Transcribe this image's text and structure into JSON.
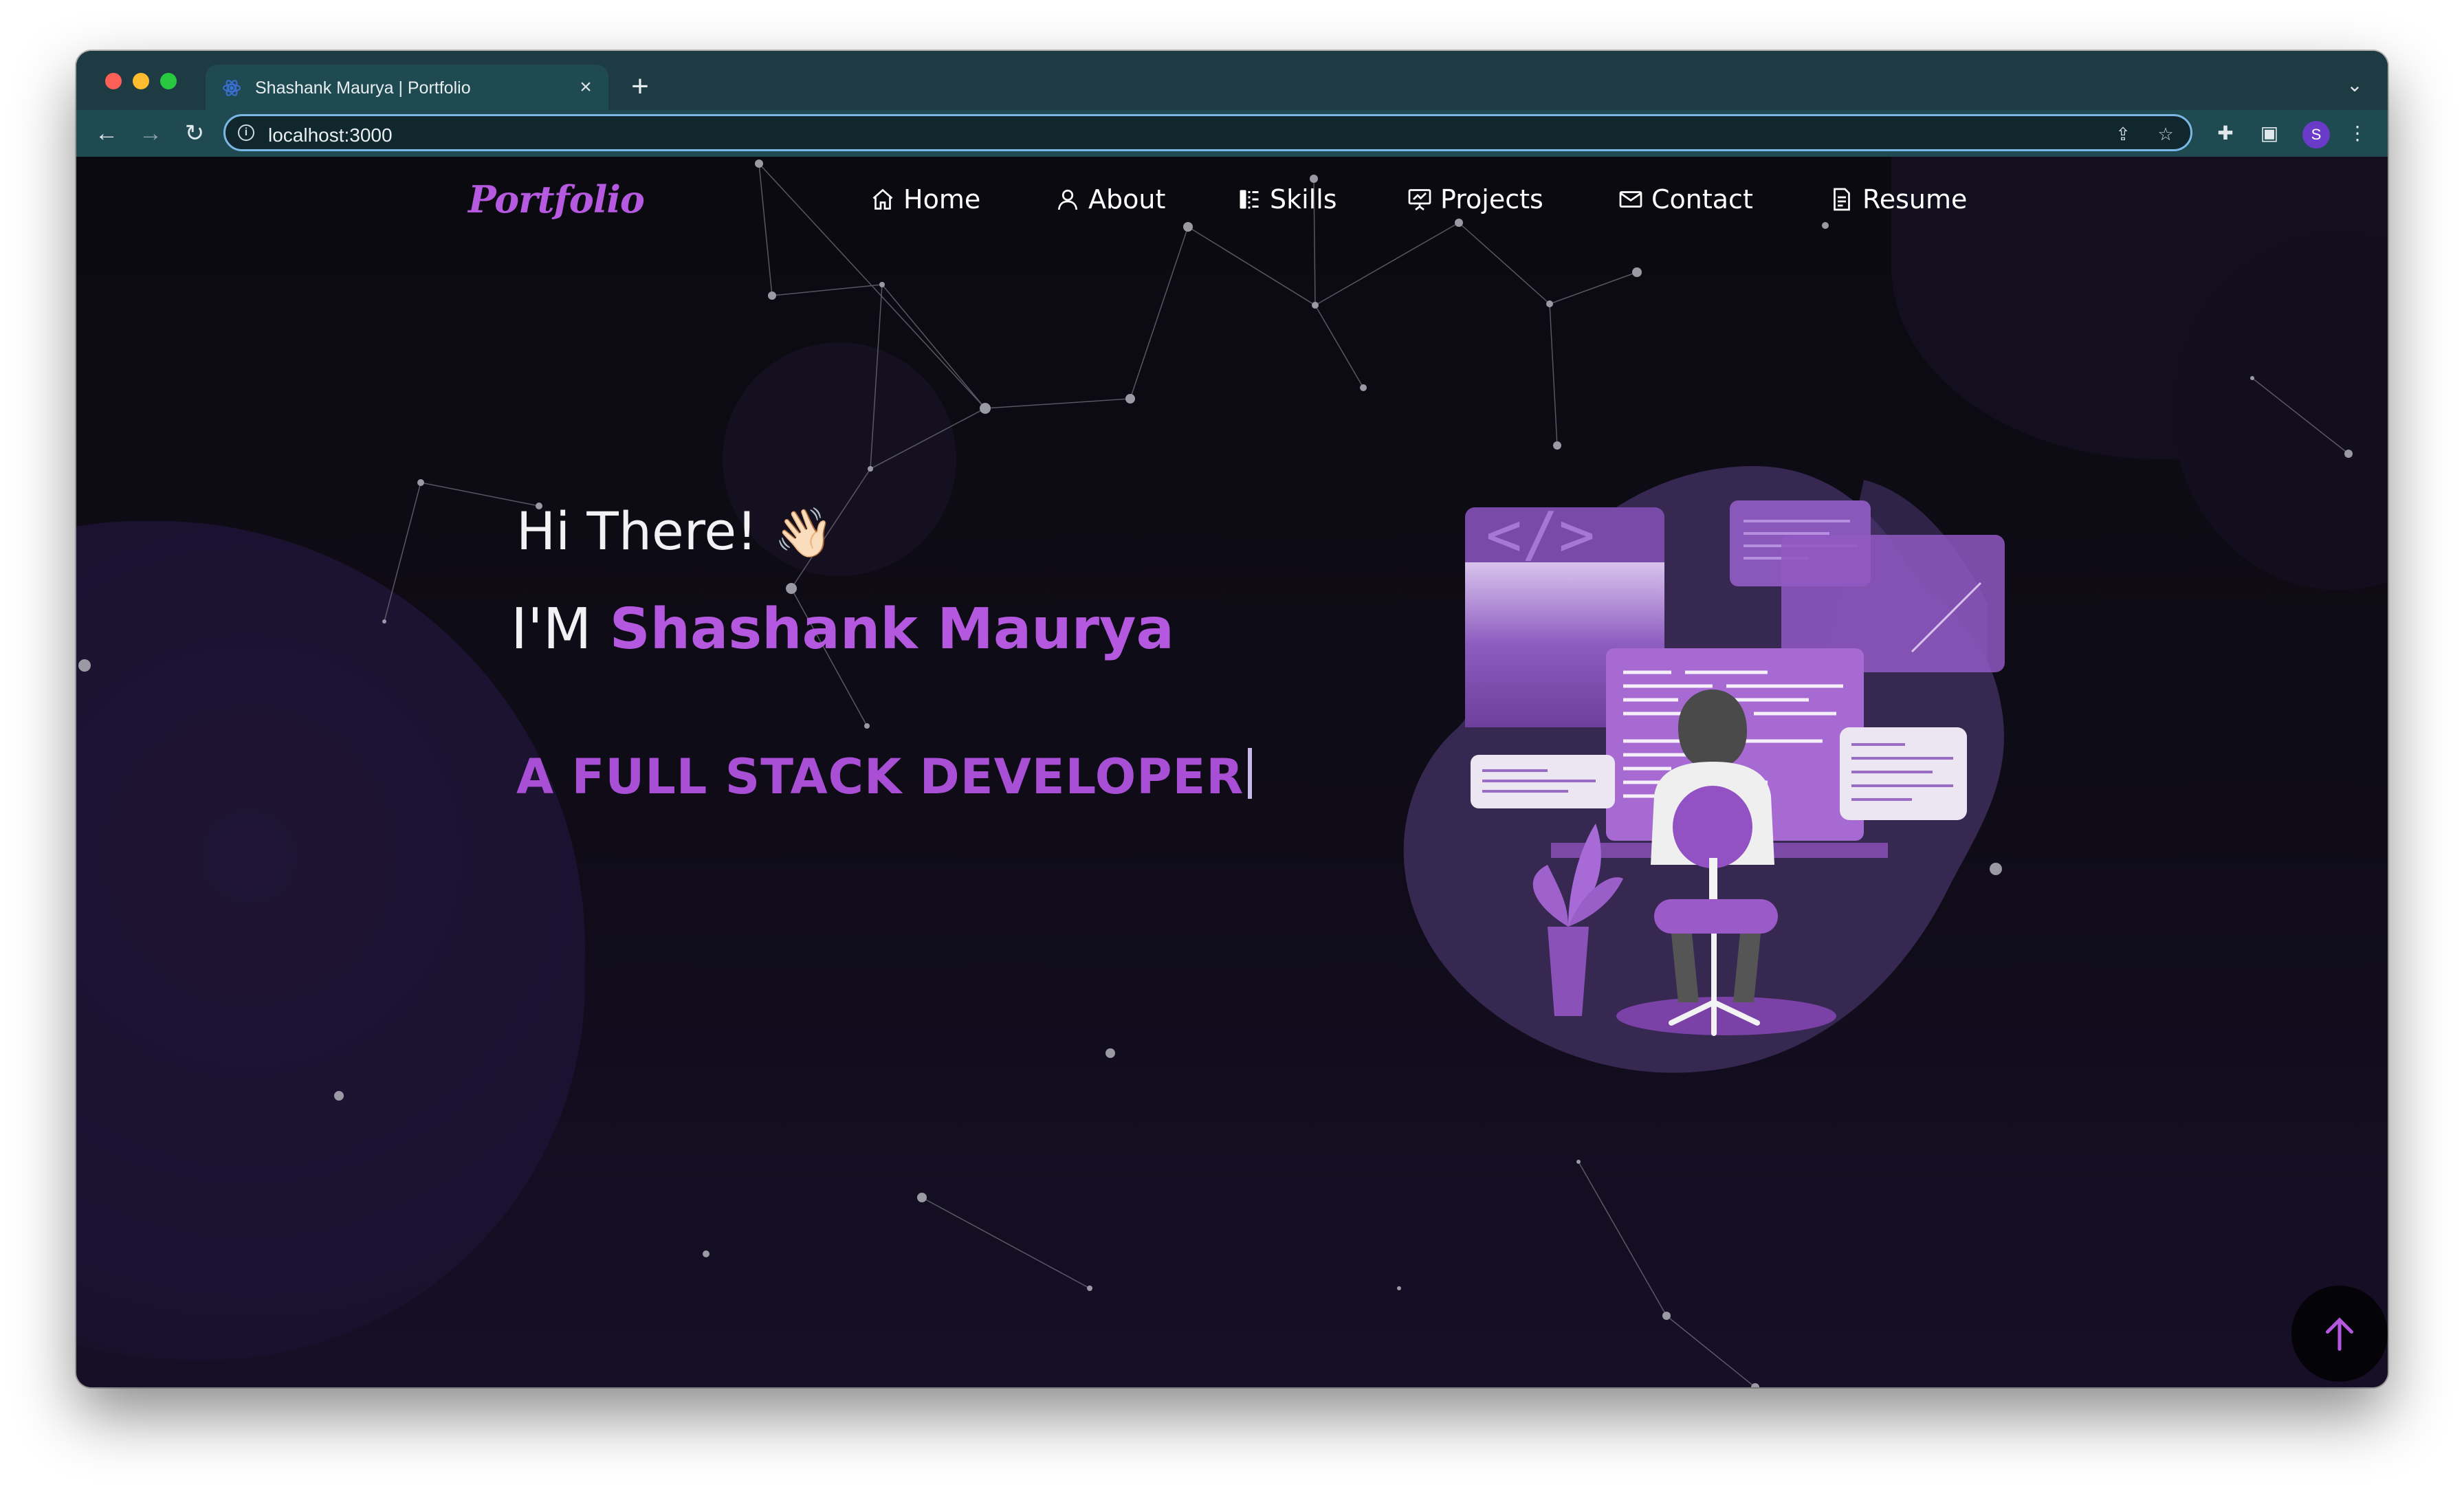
{
  "browser": {
    "tab_title": "Shashank Maurya | Portfolio",
    "tab_close_icon": "close-icon",
    "new_tab_icon": "plus-icon",
    "url": "localhost:3000",
    "profile_initial": "S",
    "colors": {
      "chrome_bg": "#1e3b44",
      "tab_bg": "#1f4a52",
      "omnibox_border": "#7cb8e6"
    }
  },
  "site": {
    "logo": "Portfolio",
    "nav": [
      {
        "label": "Home",
        "icon": "home-icon"
      },
      {
        "label": "About",
        "icon": "user-icon"
      },
      {
        "label": "Skills",
        "icon": "skills-icon"
      },
      {
        "label": "Projects",
        "icon": "presentation-icon"
      },
      {
        "label": "Contact",
        "icon": "mail-icon"
      },
      {
        "label": "Resume",
        "icon": "document-icon"
      }
    ],
    "hero": {
      "greeting": "Hi There!",
      "wave_emoji": "👋🏻",
      "im": "I'M",
      "name": "Shashank Maurya",
      "role": "A FULL STACK DEVELOPER"
    },
    "scroll_top_icon": "arrow-up-icon",
    "colors": {
      "accent": "#b458e0",
      "role": "#a84fd6",
      "background": "#0c0b13"
    }
  }
}
